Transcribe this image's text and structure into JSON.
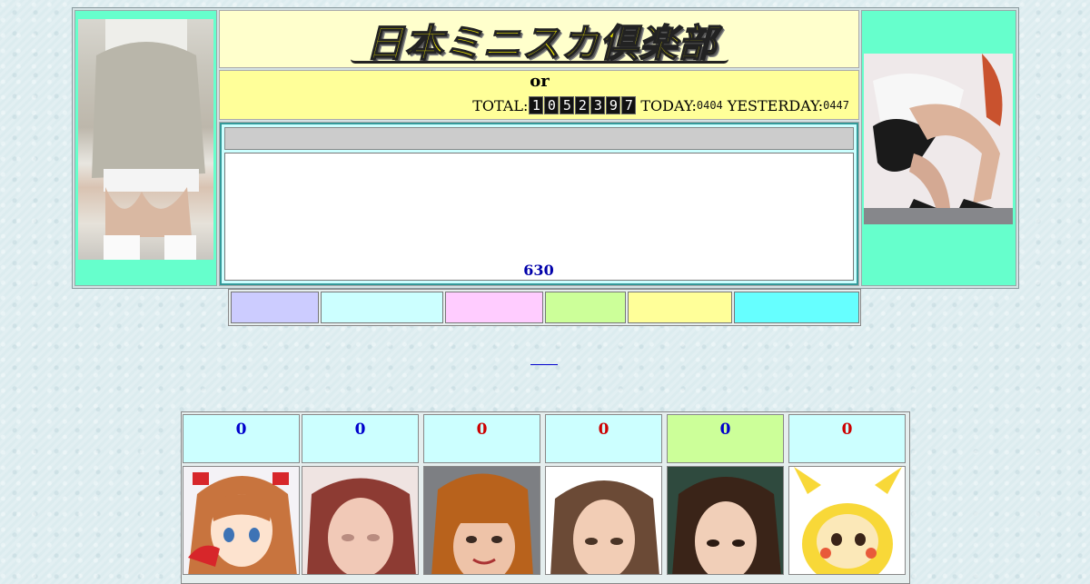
{
  "header": {
    "site_title": "日本ミニスカ倶楽部",
    "or_text": "or",
    "total_label": "TOTAL:",
    "total_digits": [
      "1",
      "0",
      "5",
      "2",
      "3",
      "9",
      "7"
    ],
    "today_label": "TODAY:",
    "today_value": "0404",
    "yesterday_label": "YESTERDAY:",
    "yesterday_value": "0447"
  },
  "news": {
    "count": "630"
  },
  "menu": {
    "buttons": [
      {
        "color": "#ccccff"
      },
      {
        "color": "#ccffff"
      },
      {
        "color": "#ffccff"
      },
      {
        "color": "#ccff99"
      },
      {
        "color": "#ffff99"
      },
      {
        "color": "#66ffff"
      }
    ]
  },
  "gallery": {
    "items": [
      {
        "count": "0",
        "count_color": "#0000cc",
        "header_bg": "#ccffff"
      },
      {
        "count": "0",
        "count_color": "#0000cc",
        "header_bg": "#ccffff"
      },
      {
        "count": "0",
        "count_color": "#cc0000",
        "header_bg": "#ccffff"
      },
      {
        "count": "0",
        "count_color": "#cc0000",
        "header_bg": "#ccffff"
      },
      {
        "count": "0",
        "count_color": "#0000cc",
        "header_bg": "#ccff99"
      },
      {
        "count": "0",
        "count_color": "#cc0000",
        "header_bg": "#ccffff"
      }
    ]
  }
}
